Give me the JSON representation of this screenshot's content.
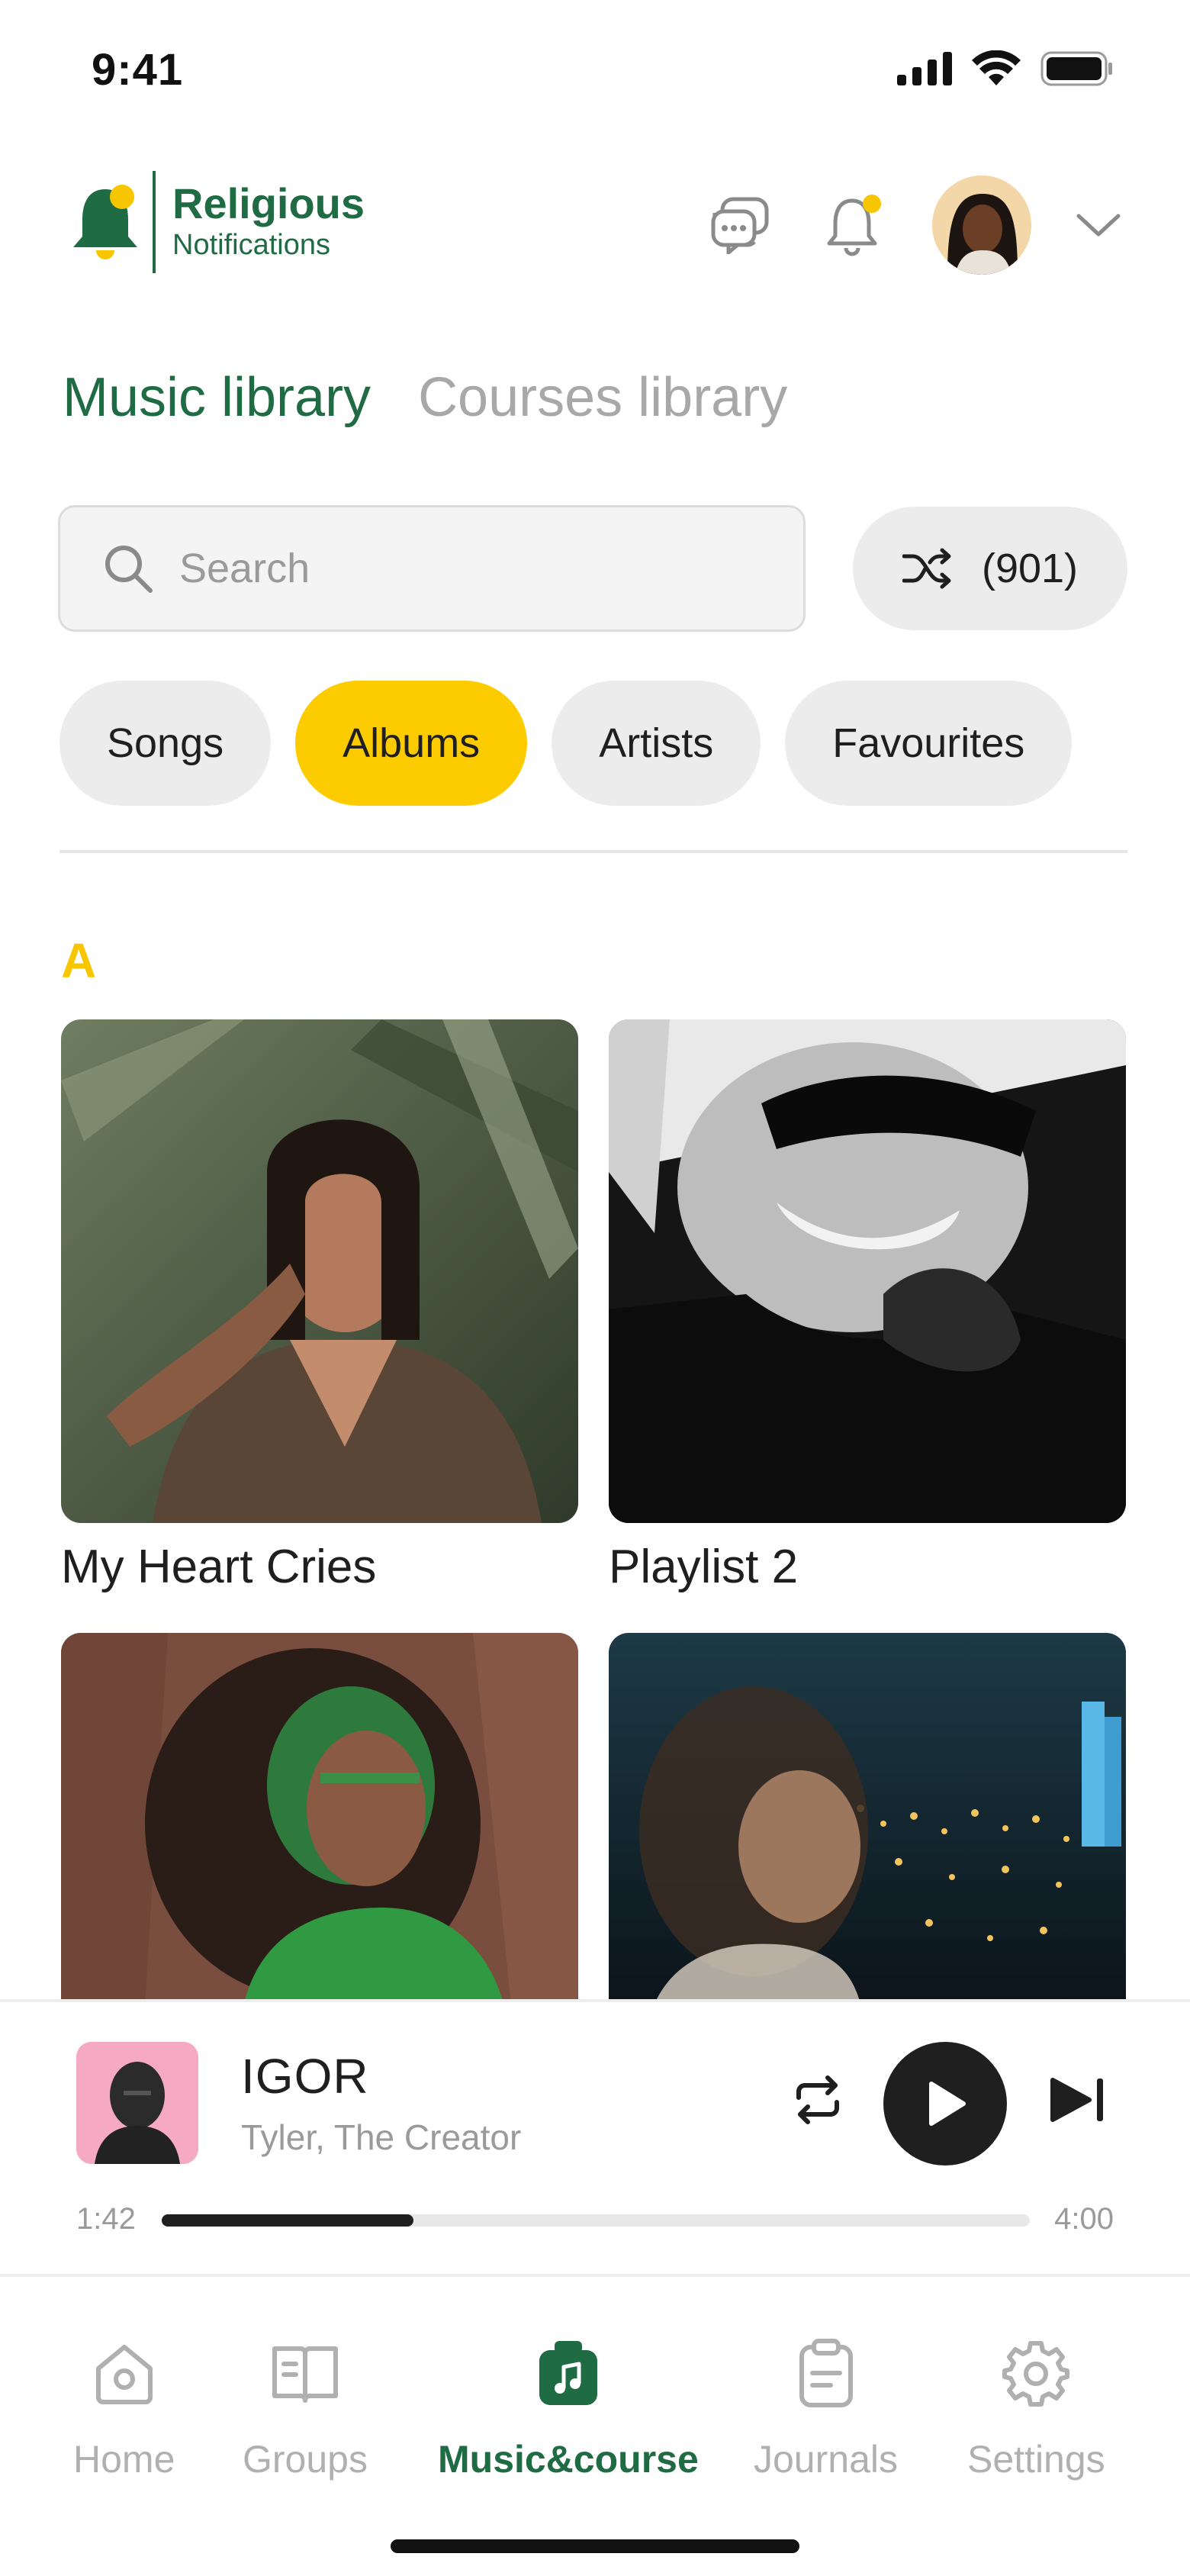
{
  "status_bar": {
    "time": "9:41",
    "icons": [
      "signal-icon",
      "wifi-icon",
      "battery-icon"
    ]
  },
  "header": {
    "logo": {
      "line1": "Religious",
      "line2": "Notifications"
    },
    "icons": [
      "chat-icon",
      "notification-bell-icon",
      "avatar",
      "chevron-down-icon"
    ]
  },
  "library_tabs": [
    {
      "label": "Music library",
      "active": true
    },
    {
      "label": "Courses library",
      "active": false
    }
  ],
  "search": {
    "placeholder": "Search"
  },
  "shuffle": {
    "count": "(901)"
  },
  "filters": [
    {
      "label": "Songs",
      "active": false
    },
    {
      "label": "Albums",
      "active": true
    },
    {
      "label": "Artists",
      "active": false
    },
    {
      "label": "Favourites",
      "active": false
    }
  ],
  "section": {
    "letter": "A"
  },
  "albums": [
    {
      "title": "My Heart Cries"
    },
    {
      "title": "Playlist 2"
    },
    {
      "title": ""
    },
    {
      "title": ""
    }
  ],
  "player": {
    "title": "IGOR",
    "artist": "Tyler, The Creator",
    "current_time": "1:42",
    "total_time": "4:00",
    "progress": 0.29
  },
  "nav": [
    {
      "label": "Home",
      "icon": "home-icon",
      "active": false
    },
    {
      "label": "Groups",
      "icon": "book-icon",
      "active": false
    },
    {
      "label": "Music&course",
      "icon": "music-bag-icon",
      "active": true
    },
    {
      "label": "Journals",
      "icon": "clipboard-icon",
      "active": false
    },
    {
      "label": "Settings",
      "icon": "gear-icon",
      "active": false
    }
  ],
  "colors": {
    "brand": "#1f6b43",
    "accent": "#fccb00",
    "dark": "#1f1f1f"
  }
}
